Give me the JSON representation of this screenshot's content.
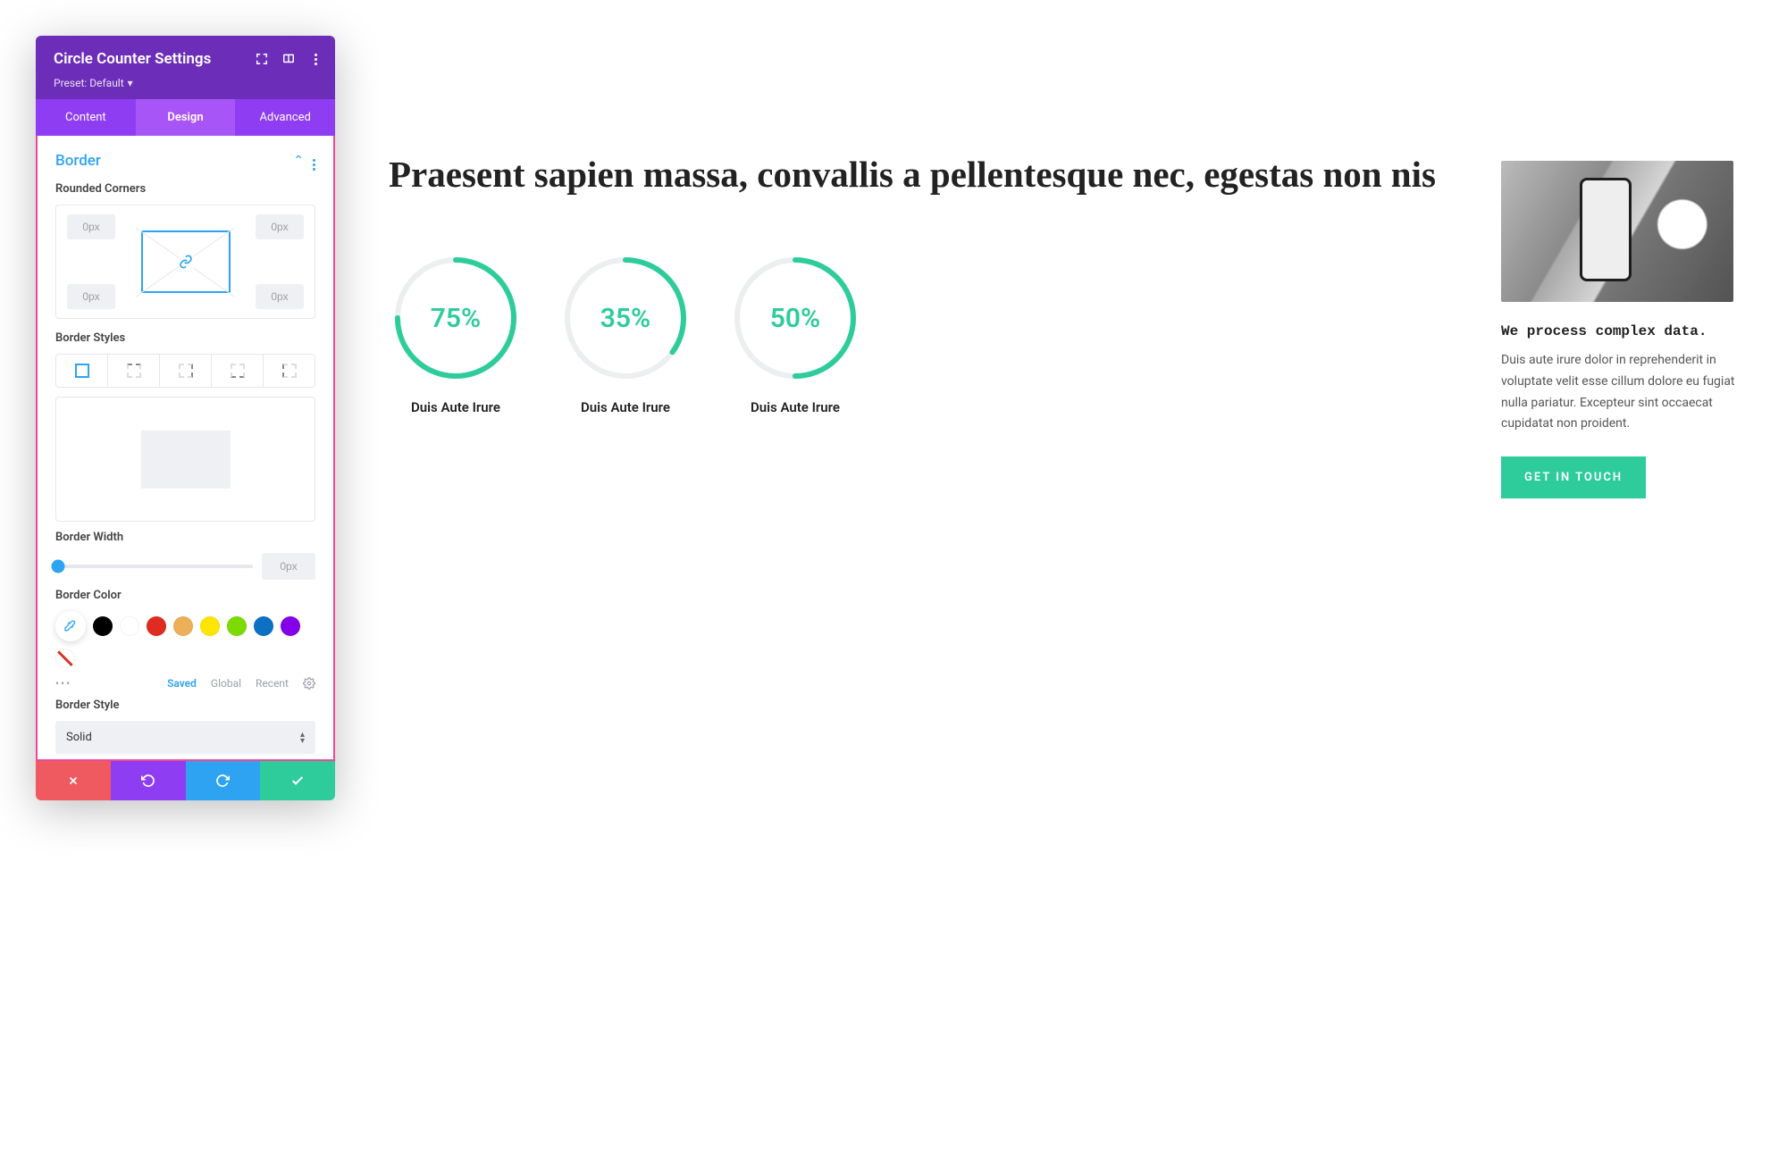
{
  "panel": {
    "title": "Circle Counter Settings",
    "preset_label": "Preset: Default",
    "tabs": {
      "content": "Content",
      "design": "Design",
      "advanced": "Advanced",
      "active": "design"
    },
    "section": {
      "title": "Border",
      "rounded_label": "Rounded Corners",
      "corner_value": "0px",
      "border_styles_label": "Border Styles",
      "border_width_label": "Border Width",
      "border_width_value": "0px",
      "border_color_label": "Border Color",
      "color_swatches": [
        "#000000",
        "#ffffff",
        "#e02b20",
        "#edb059",
        "#ffe500",
        "#7cdb00",
        "#0c71c3",
        "#8300e9"
      ],
      "color_tabs": {
        "saved": "Saved",
        "global": "Global",
        "recent": "Recent",
        "active": "saved"
      },
      "border_style_label": "Border Style",
      "border_style_value": "Solid"
    }
  },
  "content": {
    "headline": "Praesent sapien massa, convallis a pellentesque nec, egestas non nis",
    "counters": [
      {
        "value": 75,
        "label": "Duis Aute Irure"
      },
      {
        "value": 35,
        "label": "Duis Aute Irure"
      },
      {
        "value": 50,
        "label": "Duis Aute Irure"
      }
    ],
    "aside": {
      "heading": "We process complex data.",
      "body": "Duis aute irure dolor in reprehenderit in voluptate velit esse cillum dolore eu fugiat nulla pariatur. Excepteur sint occaecat cupidatat non proident.",
      "cta": "GET IN TOUCH"
    }
  },
  "chart_data": {
    "type": "pie",
    "series": [
      {
        "name": "Duis Aute Irure",
        "values": [
          75
        ]
      },
      {
        "name": "Duis Aute Irure",
        "values": [
          35
        ]
      },
      {
        "name": "Duis Aute Irure",
        "values": [
          50
        ]
      }
    ],
    "unit": "percent",
    "color": "#2ecc9b"
  }
}
